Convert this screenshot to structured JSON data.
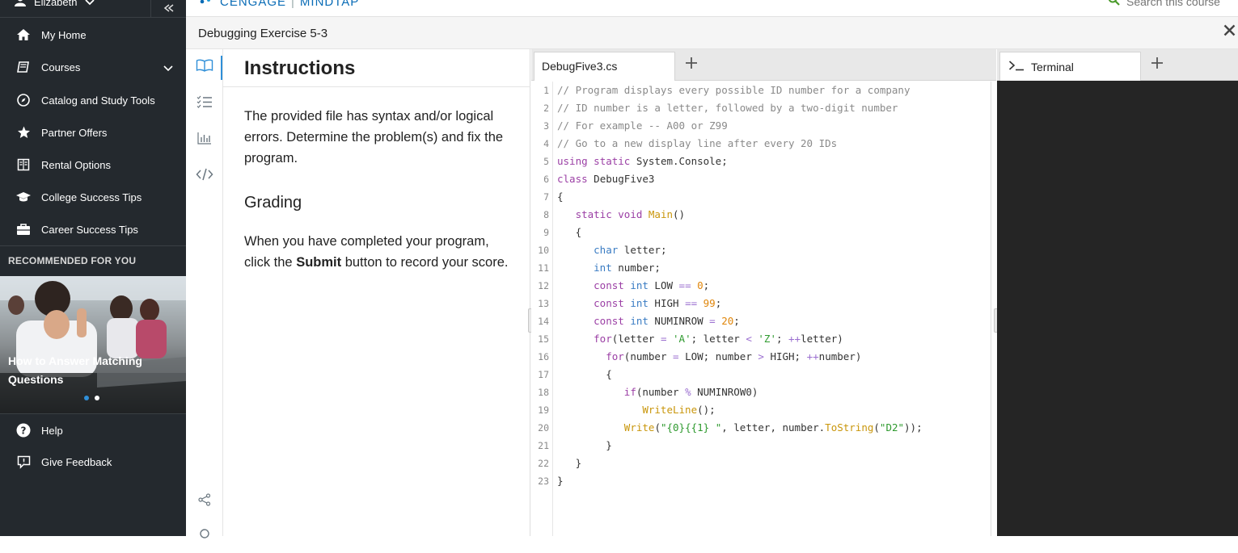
{
  "sidebar": {
    "user_name": "Elizabeth",
    "nav": [
      {
        "label": "My Home",
        "icon": "home-icon"
      },
      {
        "label": "Courses",
        "icon": "book-icon"
      },
      {
        "label": "Catalog and Study Tools",
        "icon": "compass-icon"
      },
      {
        "label": "Partner Offers",
        "icon": "star-icon"
      },
      {
        "label": "Rental Options",
        "icon": "open-book-icon"
      },
      {
        "label": "College Success Tips",
        "icon": "graduation-cap-icon"
      },
      {
        "label": "Career Success Tips",
        "icon": "briefcase-icon"
      }
    ],
    "recommended_title": "RECOMMENDED FOR YOU",
    "recommended_caption": "How to Answer Matching Questions",
    "help_label": "Help",
    "feedback_label": "Give Feedback"
  },
  "topbar": {
    "brand": "CENGAGE",
    "product": "MINDTAP",
    "search_placeholder": "Search this course"
  },
  "activity": {
    "title": "Debugging Exercise 5-3"
  },
  "instructions": {
    "title": "Instructions",
    "body": "The provided file has syntax and/or logical errors. Determine the problem(s) and fix the program.",
    "grading_title": "Grading",
    "grading_pre": "When you have completed your program, click the ",
    "grading_bold": "Submit",
    "grading_post": " button to record your score."
  },
  "editor": {
    "file_tab": "DebugFive3.cs",
    "line_numbers": [
      "1",
      "2",
      "3",
      "4",
      "5",
      "6",
      "7",
      "8",
      "9",
      "10",
      "11",
      "12",
      "13",
      "14",
      "15",
      "16",
      "17",
      "18",
      "19",
      "20",
      "21",
      "22",
      "23"
    ]
  },
  "terminal": {
    "tab_label": "Terminal"
  },
  "colors": {
    "sidebar_bg": "#24292e",
    "accent": "#2f8fd8",
    "terminal_bg": "#252525"
  }
}
